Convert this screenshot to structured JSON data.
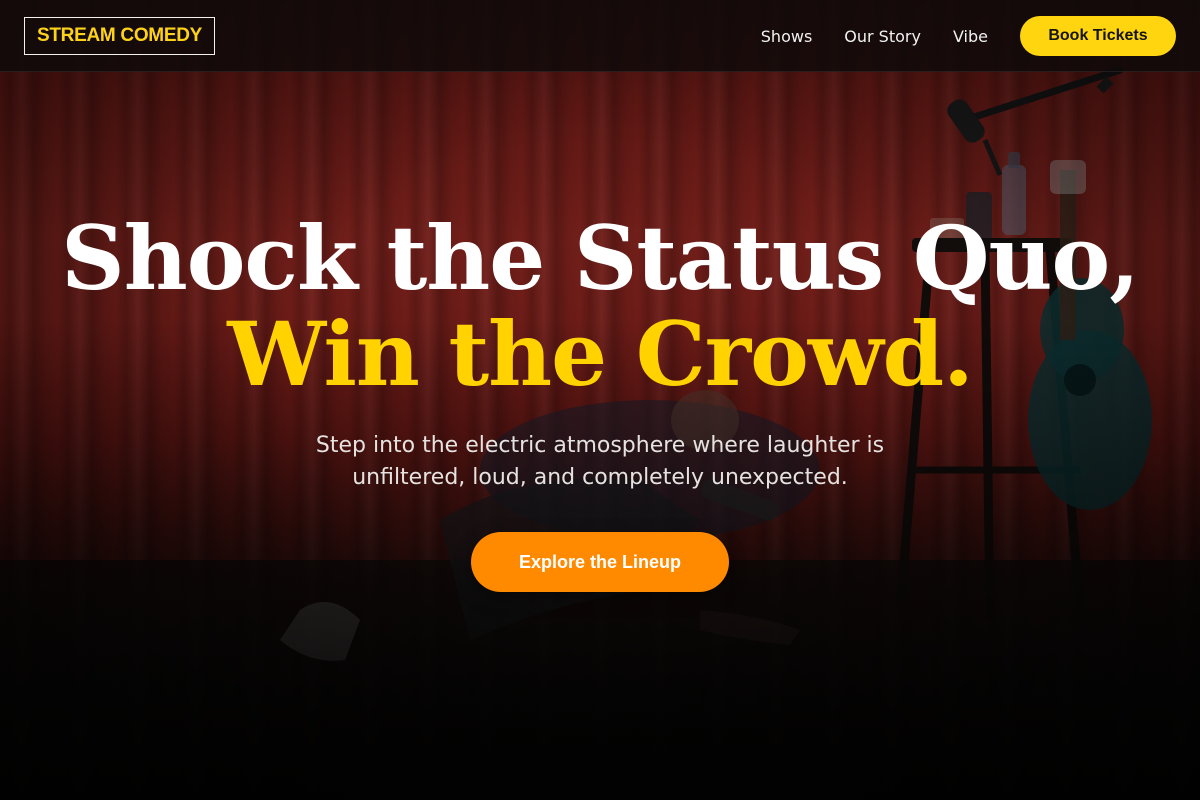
{
  "nav": {
    "logo": "STREAM COMEDY",
    "links": [
      {
        "label": "Shows"
      },
      {
        "label": "Our Story"
      },
      {
        "label": "Vibe"
      }
    ],
    "cta_label": "Book Tickets"
  },
  "hero": {
    "headline_line1": "Shock the Status Quo,",
    "headline_line2": "Win the Crowd.",
    "subtext": "Step into the electric atmosphere where laughter is unfiltered, loud, and completely unexpected.",
    "cta_label": "Explore the Lineup"
  },
  "colors": {
    "accent_yellow": "#ffd200",
    "cta_orange": "#ff8a00",
    "nav_bg": "#0e0a0a",
    "curtain_red": "#8e2620"
  }
}
